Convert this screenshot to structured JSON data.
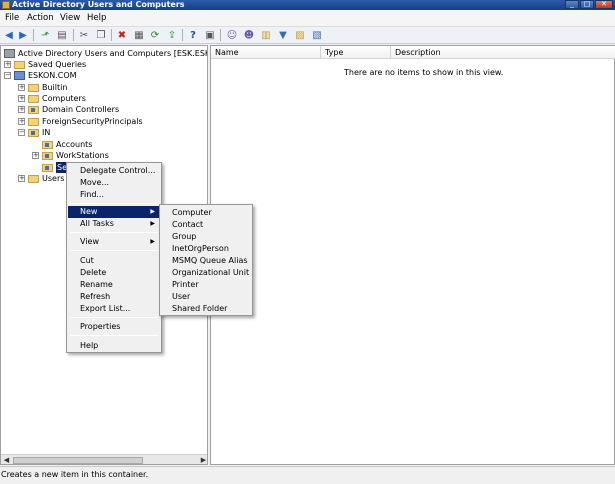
{
  "window": {
    "title": "Active Directory Users and Computers",
    "buttons": [
      "_",
      "□",
      "✕"
    ]
  },
  "menu": {
    "file": "File",
    "action": "Action",
    "view": "View",
    "help": "Help"
  },
  "tree": {
    "root": "Active Directory Users and Computers [ESK.ESKON.COM",
    "saved_queries": "Saved Queries",
    "domain": "ESKON.COM",
    "builtin": "Builtin",
    "computers": "Computers",
    "domain_controllers": "Domain Controllers",
    "foreign": "ForeignSecurityPrincipals",
    "in": "IN",
    "accounts": "Accounts",
    "workstations": "WorkStations",
    "selected_partial": "Se",
    "users": "Users"
  },
  "list": {
    "columns": [
      "Name",
      "Type",
      "Description"
    ],
    "empty_message": "There are no items to show in this view."
  },
  "context_menu": {
    "delegate": "Delegate Control...",
    "move": "Move...",
    "find": "Find...",
    "new": "New",
    "all_tasks": "All Tasks",
    "view": "View",
    "cut": "Cut",
    "delete": "Delete",
    "rename": "Rename",
    "refresh": "Refresh",
    "export": "Export List...",
    "properties": "Properties",
    "help": "Help"
  },
  "new_submenu": [
    "Computer",
    "Contact",
    "Group",
    "InetOrgPerson",
    "MSMQ Queue Alias",
    "Organizational Unit",
    "Printer",
    "User",
    "Shared Folder"
  ],
  "status": {
    "text": "Creates a new item in this container."
  }
}
